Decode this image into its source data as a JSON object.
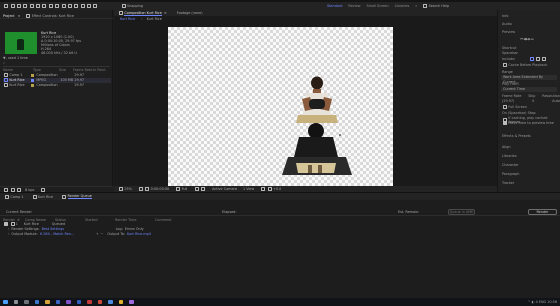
{
  "toolbar": {
    "snapping": "Snapping",
    "workspaces": [
      "Standard",
      "Review",
      "Small Screen",
      "Libraries"
    ],
    "active_workspace": "Standard",
    "search": "Search Help"
  },
  "project": {
    "tab_label": "Project",
    "effect_controls_tab": "Effect Controls: Kurt Rice",
    "thumb_name": "Kurt Rice",
    "thumb_info": [
      "1920 x 1080 (1.00)",
      "Δ 0:00:10:00, 29.97 fps",
      "Millions of Colors",
      "H.264",
      "48.000 kHz / 32 bit U"
    ],
    "thumb_caption": "▼, used 1 time",
    "search_placeholder": "⌕",
    "columns": [
      "Name",
      "Type",
      "Size",
      "Frame Rate",
      "In Point"
    ],
    "items": [
      {
        "name": "Comp 1",
        "type": "Composition",
        "size": "",
        "fps": "29.97",
        "color": "#b9a14a",
        "selected": false
      },
      {
        "name": "Kurt Rice",
        "type": "MPEG",
        "size": "105 MB",
        "fps": "29.97",
        "color": "#6f86ff",
        "selected": true
      },
      {
        "name": "Kurt Rice",
        "type": "Composition",
        "size": "",
        "fps": "29.97",
        "color": "#b9a14a",
        "selected": false
      }
    ],
    "bottom_bits": "8 bpc"
  },
  "viewer": {
    "tabs": [
      {
        "label": "Composition Kurt Rice",
        "active": true
      },
      {
        "label": "Footage (none)",
        "active": false
      }
    ],
    "subtabs": [
      "Kurt Rice",
      "Kurt Rice"
    ],
    "zoom": "25%",
    "timecode": "0:00:00:00",
    "resolution": "Full",
    "camera": "Active Camera",
    "view": "1 View",
    "exposure": "+0.0"
  },
  "right_panel": {
    "items": [
      "Info",
      "Audio",
      "Preview",
      "Shortcut",
      "Effects & Presets",
      "Align",
      "Libraries",
      "Character",
      "Paragraph",
      "Tracker"
    ],
    "preview_label": "Preview",
    "include_label": "Include:",
    "shortcut_value": "Spacebar",
    "cache_label": "Cache Before Playback",
    "range_label": "Range",
    "range_value": "Work Area Extended By Current...",
    "play_from": "Play From",
    "play_from_value": "Current Time",
    "frame_rate": "Frame Rate",
    "skip": "Skip",
    "resolution": "Resolution",
    "fr_value": "(29.97)",
    "skip_value": "0",
    "res_value": "Auto",
    "fullscreen": "Full Screen",
    "on_stop": "On (Spacebar) Stop:",
    "if_caching": "If caching, play cached frames",
    "move_time": "Move time to preview time",
    "effects": "Effects & Presets",
    "align": "Align",
    "libraries": "Libraries",
    "character": "Character",
    "paragraph": "Paragraph",
    "tracker": "Tracker"
  },
  "timeline": {
    "tabs": [
      {
        "label": "Comp 1",
        "active": false
      },
      {
        "label": "Kurt Rice",
        "active": false
      },
      {
        "label": "Render Queue",
        "active": true
      }
    ],
    "current_render": "Current Render",
    "elapsed": "Elapsed:",
    "est_remain": "Est. Remain:",
    "queue_btn": "Queue in AME",
    "render_btn": "Render",
    "columns": [
      "Render",
      "#",
      "Comp Name",
      "Status",
      "Started",
      "Render Time",
      "Comment"
    ],
    "layer": {
      "num": "1",
      "name": "Kurt Rice",
      "status": "Queued"
    },
    "render_settings_label": "Render Settings:",
    "render_settings_value": "Best Settings",
    "output_module_label": "Output Module:",
    "output_module_value": "H.264 - Match Ren...",
    "log_label": "Log:",
    "log_value": "Errors Only",
    "output_to_label": "Output To:",
    "output_to_value": "Kurt Rice.mp4"
  },
  "taskbar": {
    "tray": "^ ◐ 4 ENG 10:56"
  },
  "colors": {
    "accent": "#6f86ff",
    "label_yellow": "#b9a14a",
    "thumb_green": "#1f8f2e"
  }
}
